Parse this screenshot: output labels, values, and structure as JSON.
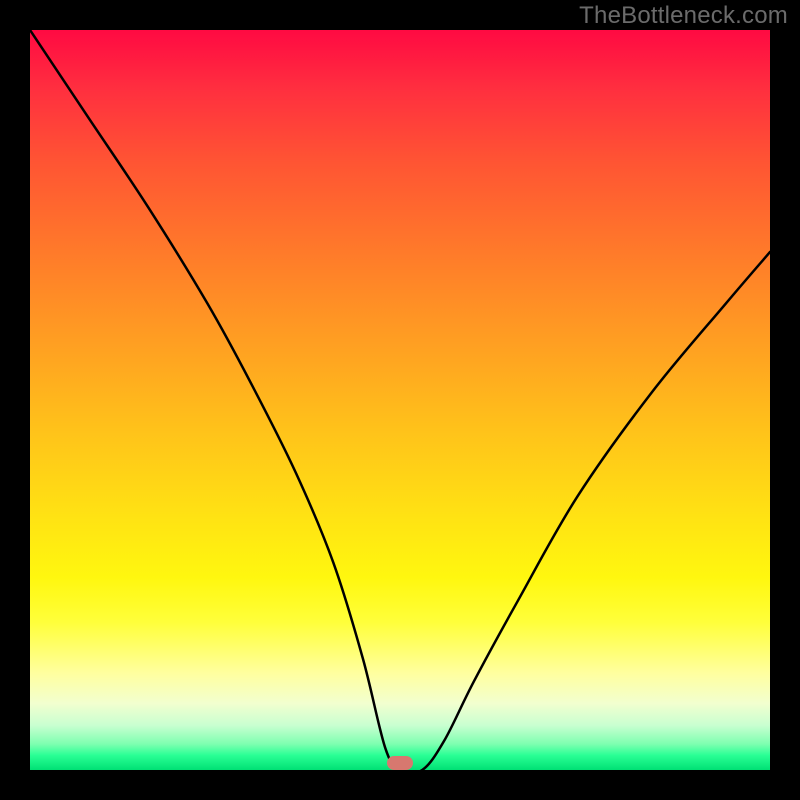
{
  "watermark": "TheBottleneck.com",
  "marker": {
    "x_pct": 50,
    "y_pct": 99
  },
  "chart_data": {
    "type": "line",
    "title": "",
    "xlabel": "",
    "ylabel": "",
    "xlim": [
      0,
      100
    ],
    "ylim": [
      0,
      100
    ],
    "series": [
      {
        "name": "bottleneck-curve",
        "x": [
          0,
          8,
          16,
          24,
          30,
          36,
          41,
          45,
          48,
          50,
          53,
          56,
          60,
          66,
          74,
          84,
          94,
          100
        ],
        "values": [
          100,
          88,
          76,
          63,
          52,
          40,
          28,
          15,
          3,
          0,
          0,
          4,
          12,
          23,
          37,
          51,
          63,
          70
        ]
      }
    ],
    "gradient_stops": [
      {
        "pct": 0,
        "color": "#ff0a42"
      },
      {
        "pct": 8,
        "color": "#ff2f3f"
      },
      {
        "pct": 18,
        "color": "#ff5533"
      },
      {
        "pct": 30,
        "color": "#ff7a2a"
      },
      {
        "pct": 42,
        "color": "#ff9e22"
      },
      {
        "pct": 54,
        "color": "#ffc21a"
      },
      {
        "pct": 66,
        "color": "#ffe313"
      },
      {
        "pct": 74,
        "color": "#fff70f"
      },
      {
        "pct": 80,
        "color": "#ffff3a"
      },
      {
        "pct": 87,
        "color": "#ffffa0"
      },
      {
        "pct": 91,
        "color": "#f2ffcf"
      },
      {
        "pct": 94,
        "color": "#c8ffd0"
      },
      {
        "pct": 96.5,
        "color": "#7dffb0"
      },
      {
        "pct": 98,
        "color": "#2aff95"
      },
      {
        "pct": 100,
        "color": "#00e074"
      }
    ],
    "marker": {
      "x": 50,
      "y": 0,
      "color": "#d7786f"
    }
  }
}
